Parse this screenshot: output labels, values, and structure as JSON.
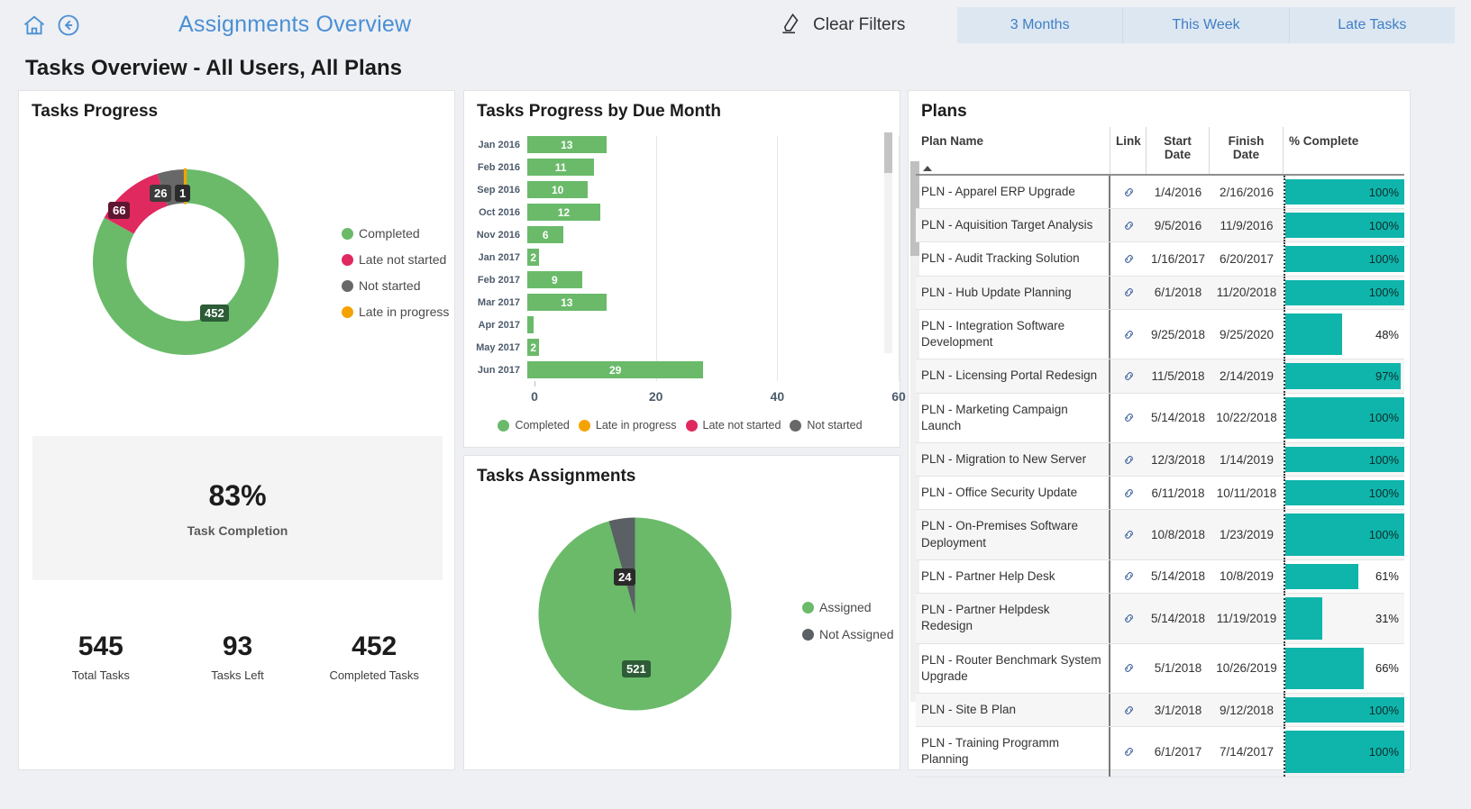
{
  "header": {
    "report_title": "Assignments Overview",
    "home_icon": "home-icon",
    "back_icon": "back-arrow-icon",
    "clear_filters_label": "Clear Filters",
    "clear_filters_icon": "eraser-icon",
    "filter_tabs": [
      {
        "label": "3 Months"
      },
      {
        "label": "This Week"
      },
      {
        "label": "Late Tasks"
      }
    ]
  },
  "page_heading": "Tasks Overview - All Users, All Plans",
  "colors": {
    "completed": "#6aba6a",
    "late_not_started": "#e0295f",
    "not_started": "#686868",
    "late_in_progress": "#f5a302",
    "teal": "#0fb5ab",
    "accent_blue": "#4a8fd4"
  },
  "panels": {
    "tasks_progress": {
      "title": "Tasks Progress"
    },
    "tasks_by_month": {
      "title": "Tasks Progress by Due Month"
    },
    "tasks_assignments": {
      "title": "Tasks Assignments"
    },
    "plans": {
      "title": "Plans"
    }
  },
  "kpi": {
    "completion_pct": "83%",
    "completion_label": "Task Completion",
    "cells": [
      {
        "value": "545",
        "label": "Total Tasks"
      },
      {
        "value": "93",
        "label": "Tasks Left"
      },
      {
        "value": "452",
        "label": "Completed Tasks"
      }
    ]
  },
  "plans_table": {
    "columns": [
      "Plan Name",
      "Link",
      "Start Date",
      "Finish Date",
      "% Complete"
    ],
    "sorted_by": "Plan Name",
    "sort_direction": "asc",
    "link_icon": "link-icon",
    "rows": [
      {
        "name": "PLN - Apparel ERP Upgrade",
        "link": "link-icon",
        "start": "1/4/2016",
        "finish": "2/16/2016",
        "pct": 100,
        "pct_label": "100%"
      },
      {
        "name": "PLN - Aquisition Target Analysis",
        "link": "link-icon",
        "start": "9/5/2016",
        "finish": "11/9/2016",
        "pct": 100,
        "pct_label": "100%"
      },
      {
        "name": "PLN - Audit Tracking Solution",
        "link": "link-icon",
        "start": "1/16/2017",
        "finish": "6/20/2017",
        "pct": 100,
        "pct_label": "100%"
      },
      {
        "name": "PLN - Hub Update Planning",
        "link": "link-icon",
        "start": "6/1/2018",
        "finish": "11/20/2018",
        "pct": 100,
        "pct_label": "100%"
      },
      {
        "name": "PLN - Integration Software Development",
        "link": "link-icon",
        "start": "9/25/2018",
        "finish": "9/25/2020",
        "pct": 48,
        "pct_label": "48%"
      },
      {
        "name": "PLN - Licensing Portal Redesign",
        "link": "link-icon",
        "start": "11/5/2018",
        "finish": "2/14/2019",
        "pct": 97,
        "pct_label": "97%"
      },
      {
        "name": "PLN - Marketing Campaign Launch",
        "link": "link-icon",
        "start": "5/14/2018",
        "finish": "10/22/2018",
        "pct": 100,
        "pct_label": "100%"
      },
      {
        "name": "PLN - Migration to New Server",
        "link": "link-icon",
        "start": "12/3/2018",
        "finish": "1/14/2019",
        "pct": 100,
        "pct_label": "100%"
      },
      {
        "name": "PLN - Office Security Update",
        "link": "link-icon",
        "start": "6/11/2018",
        "finish": "10/11/2018",
        "pct": 100,
        "pct_label": "100%"
      },
      {
        "name": "PLN - On-Premises Software Deployment",
        "link": "link-icon",
        "start": "10/8/2018",
        "finish": "1/23/2019",
        "pct": 100,
        "pct_label": "100%"
      },
      {
        "name": "PLN - Partner Help Desk",
        "link": "link-icon",
        "start": "5/14/2018",
        "finish": "10/8/2019",
        "pct": 61,
        "pct_label": "61%"
      },
      {
        "name": "PLN - Partner Helpdesk Redesign",
        "link": "link-icon",
        "start": "5/14/2018",
        "finish": "11/19/2019",
        "pct": 31,
        "pct_label": "31%"
      },
      {
        "name": "PLN - Router Benchmark System Upgrade",
        "link": "link-icon",
        "start": "5/1/2018",
        "finish": "10/26/2019",
        "pct": 66,
        "pct_label": "66%"
      },
      {
        "name": "PLN - Site B Plan",
        "link": "link-icon",
        "start": "3/1/2018",
        "finish": "9/12/2018",
        "pct": 100,
        "pct_label": "100%"
      },
      {
        "name": "PLN - Training Programm Planning",
        "link": "link-icon",
        "start": "6/1/2017",
        "finish": "7/14/2017",
        "pct": 100,
        "pct_label": "100%"
      }
    ]
  },
  "chart_data": [
    {
      "type": "pie",
      "title": "Tasks Progress",
      "variant": "donut",
      "labels": [
        "Completed",
        "Late not started",
        "Not started",
        "Late in progress"
      ],
      "values": [
        452,
        66,
        26,
        1
      ],
      "colors": [
        "#6aba6a",
        "#e0295f",
        "#686868",
        "#f5a302"
      ],
      "data_labels": [
        "452",
        "66",
        "26",
        "1"
      ],
      "legend_position": "right",
      "total": 545
    },
    {
      "type": "bar",
      "title": "Tasks Progress by Due Month",
      "orientation": "horizontal",
      "categories": [
        "Jan 2016",
        "Feb 2016",
        "Sep 2016",
        "Oct 2016",
        "Nov 2016",
        "Jan 2017",
        "Feb 2017",
        "Mar 2017",
        "Apr 2017",
        "May 2017",
        "Jun 2017"
      ],
      "series": [
        {
          "name": "Completed",
          "color": "#6aba6a",
          "values": [
            13,
            11,
            10,
            12,
            6,
            2,
            9,
            13,
            1,
            2,
            29
          ]
        }
      ],
      "data_labels": [
        "13",
        "11",
        "10",
        "12",
        "6",
        "2",
        "9",
        "13",
        "",
        "2",
        "29"
      ],
      "xlabel": "",
      "ylabel": "",
      "xlim": [
        0,
        60
      ],
      "xticks": [
        "0",
        "20",
        "40",
        "60"
      ],
      "grid": true,
      "legend_position": "bottom",
      "legend": [
        {
          "label": "Completed",
          "color": "#6aba6a"
        },
        {
          "label": "Late in progress",
          "color": "#f5a302"
        },
        {
          "label": "Late not started",
          "color": "#e0295f"
        },
        {
          "label": "Not started",
          "color": "#686868"
        }
      ],
      "scrollable": true
    },
    {
      "type": "pie",
      "title": "Tasks Assignments",
      "variant": "pie",
      "labels": [
        "Assigned",
        "Not Assigned"
      ],
      "values": [
        521,
        24
      ],
      "colors": [
        "#6aba6a",
        "#5a6063"
      ],
      "data_labels": [
        "521",
        "24"
      ],
      "legend_position": "right",
      "total": 545
    }
  ]
}
